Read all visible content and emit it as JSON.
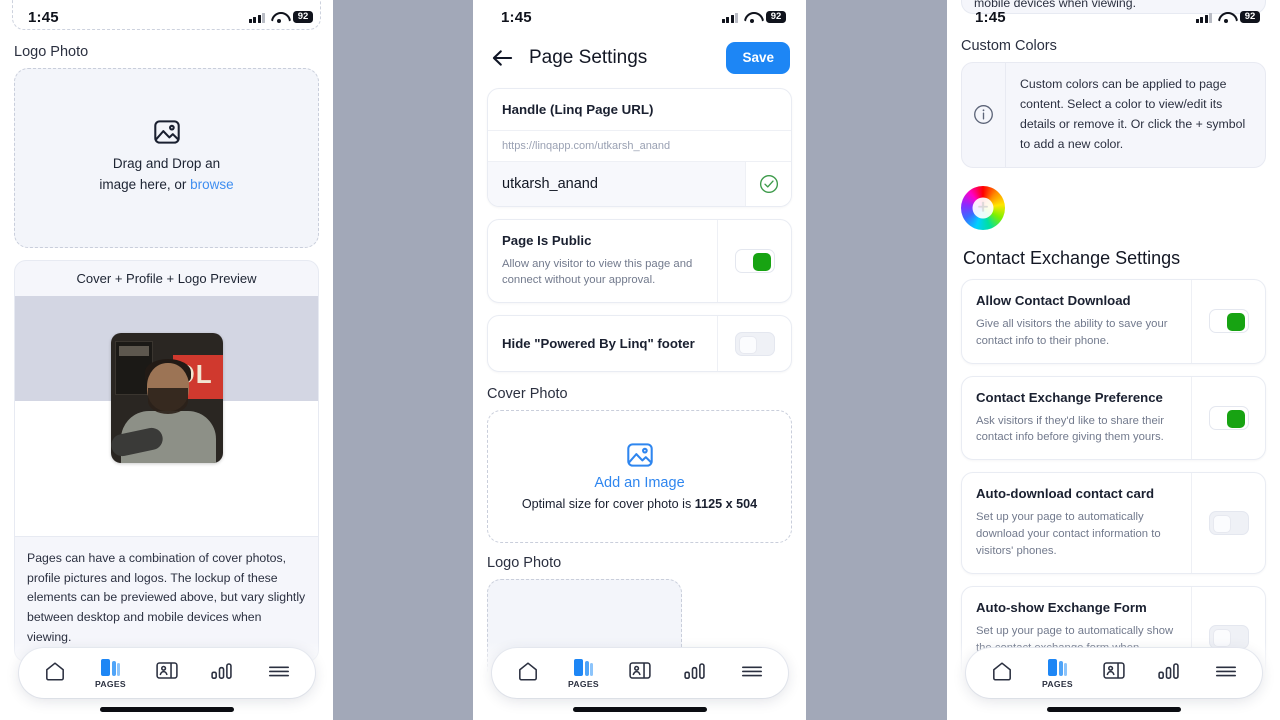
{
  "status_bar": {
    "time": "1:45",
    "battery": "92",
    "wifi_icon": "wifi-icon",
    "cellular_icon": "cellular-bars-icon"
  },
  "tabbar": {
    "items": [
      {
        "name": "home",
        "label": "",
        "icon": "home-icon",
        "active": false
      },
      {
        "name": "pages",
        "label": "PAGES",
        "icon": "pages-stack-icon",
        "active": true
      },
      {
        "name": "contacts",
        "label": "",
        "icon": "contact-card-icon",
        "active": false
      },
      {
        "name": "analytics",
        "label": "",
        "icon": "bar-chart-icon",
        "active": false
      },
      {
        "name": "menu",
        "label": "",
        "icon": "hamburger-menu-icon",
        "active": false
      }
    ]
  },
  "panel1": {
    "ghost_text": "mobile devices when viewing.",
    "logo_photo_label": "Logo Photo",
    "dropzone": {
      "line1": "Drag and Drop an",
      "line2_prefix": "image here, or ",
      "link": "browse",
      "icon": "image-placeholder-icon"
    },
    "preview_card": {
      "header": "Cover + Profile + Logo Preview",
      "note": "Pages can have a combination of cover photos, profile pictures and logos. The lockup of these elements can be previewed above, but vary slightly between desktop and mobile devices when viewing."
    },
    "custom_colors_label": "Custom Colors"
  },
  "panel2": {
    "nav": {
      "back_icon": "back-arrow-icon",
      "title": "Page Settings",
      "save_label": "Save"
    },
    "handle": {
      "label": "Handle (Linq Page URL)",
      "url": "https://linqapp.com/utkarsh_anand",
      "value": "utkarsh_anand",
      "valid_icon": "check-circle-icon"
    },
    "toggles": [
      {
        "title": "Page Is Public",
        "sub": "Allow any visitor to view this page and connect without your approval.",
        "state": "on"
      },
      {
        "title": "Hide \"Powered By Linq\" footer",
        "sub": "",
        "state": "off"
      }
    ],
    "cover_photo": {
      "label": "Cover Photo",
      "add_link": "Add an Image",
      "note_prefix": "Optimal size for cover photo is ",
      "note_size": "1125 x 504",
      "icon": "image-placeholder-icon"
    },
    "logo_photo_label": "Logo Photo"
  },
  "panel3": {
    "ghost_text": "mobile devices when viewing.",
    "custom_colors_label": "Custom Colors",
    "info": {
      "icon": "info-circle-icon",
      "text": "Custom colors can be applied to page content. Select a color to view/edit its details or remove it. Or click the + symbol to add a new color."
    },
    "add_color": {
      "icon": "color-wheel-add-icon",
      "plus": "+"
    },
    "contact_section_title": "Contact Exchange Settings",
    "toggles": [
      {
        "title": "Allow Contact Download",
        "sub": "Give all visitors the ability to save your contact info to their phone.",
        "state": "on"
      },
      {
        "title": "Contact Exchange Preference",
        "sub": "Ask visitors if they'd like to share their contact info before giving them yours.",
        "state": "on"
      },
      {
        "title": "Auto-download contact card",
        "sub": "Set up your page to automatically download your contact information to visitors' phones.",
        "state": "off"
      },
      {
        "title": "Auto-show Exchange Form",
        "sub": "Set up your page to automatically show the contact exchange form when visitors open the",
        "state": "off"
      }
    ]
  },
  "colors": {
    "accent_blue": "#1d86f5",
    "toggle_on_green": "#17a312",
    "background_gap": "#a2a8b8",
    "link_blue": "#3f8ef0"
  }
}
